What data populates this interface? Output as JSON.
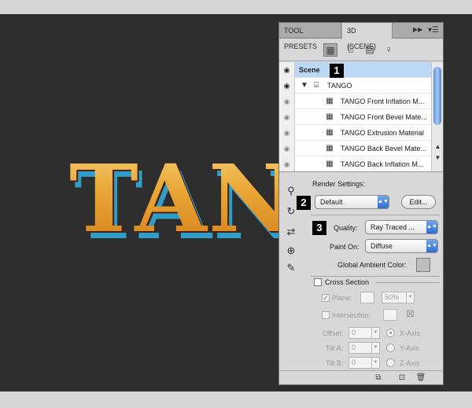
{
  "canvas": {
    "artwork_text": "TANGO"
  },
  "panel": {
    "tabs": [
      {
        "label": "TOOL PRESETS"
      },
      {
        "label": "3D {SCENE}"
      }
    ],
    "tab_more_icon": "double-chevron-icon",
    "menu_icon": "panel-menu-icon",
    "toolbar": [
      {
        "icon": "scene-icon",
        "active": true
      },
      {
        "icon": "mesh-icon",
        "active": false
      },
      {
        "icon": "materials-icon",
        "active": false
      },
      {
        "icon": "light-bulb-icon",
        "active": false
      }
    ],
    "scene_list": [
      {
        "label": "Scene",
        "type": "scene",
        "visible": true,
        "selected": true
      },
      {
        "label": "TANGO",
        "type": "mesh",
        "visible": true,
        "expanded": true
      },
      {
        "label": "TANGO Front Inflation M...",
        "type": "material",
        "visible": false
      },
      {
        "label": "TANGO Front Bevel Mate...",
        "type": "material",
        "visible": false
      },
      {
        "label": "TANGO Extrusion Material",
        "type": "material",
        "visible": false
      },
      {
        "label": "TANGO Back Bevel Mate...",
        "type": "material",
        "visible": false
      },
      {
        "label": "TANGO Back Inflation M...",
        "type": "material",
        "visible": false
      }
    ],
    "badges": [
      "1",
      "2",
      "3"
    ],
    "render_settings": {
      "heading": "Render Settings:",
      "preset": "Default",
      "edit_label": "Edit...",
      "quality_label": "Quality:",
      "quality_value": "Ray Traced ...",
      "paint_on_label": "Paint On:",
      "paint_on_value": "Diffuse",
      "ambient_label": "Global Ambient Color:",
      "ambient_color": "#bdbdbd"
    },
    "cross_section": {
      "heading": "Cross Section",
      "enabled": false,
      "plane_label": "Plane:",
      "plane_checked": true,
      "plane_opacity": "50%",
      "intersection_label": "Intersection:",
      "offset_label": "Offset:",
      "offset_value": "0",
      "tilt_a_label": "Tilt A:",
      "tilt_a_value": "0",
      "tilt_b_label": "Tilt B:",
      "tilt_b_value": "0",
      "axes": [
        "X-Axis",
        "Y-Axis",
        "Z-Axis"
      ],
      "selected_axis": "X-Axis"
    },
    "footer_icons": [
      "toggle-ground-plane-icon",
      "new-item-icon",
      "trash-icon"
    ]
  },
  "colors": {
    "canvas_bg": "#2d2d2d",
    "selection": "#bad7f5",
    "accent_blue": "#2f6fd0",
    "text_face": "#e9a534",
    "text_extrude": "#2e9ec9"
  }
}
